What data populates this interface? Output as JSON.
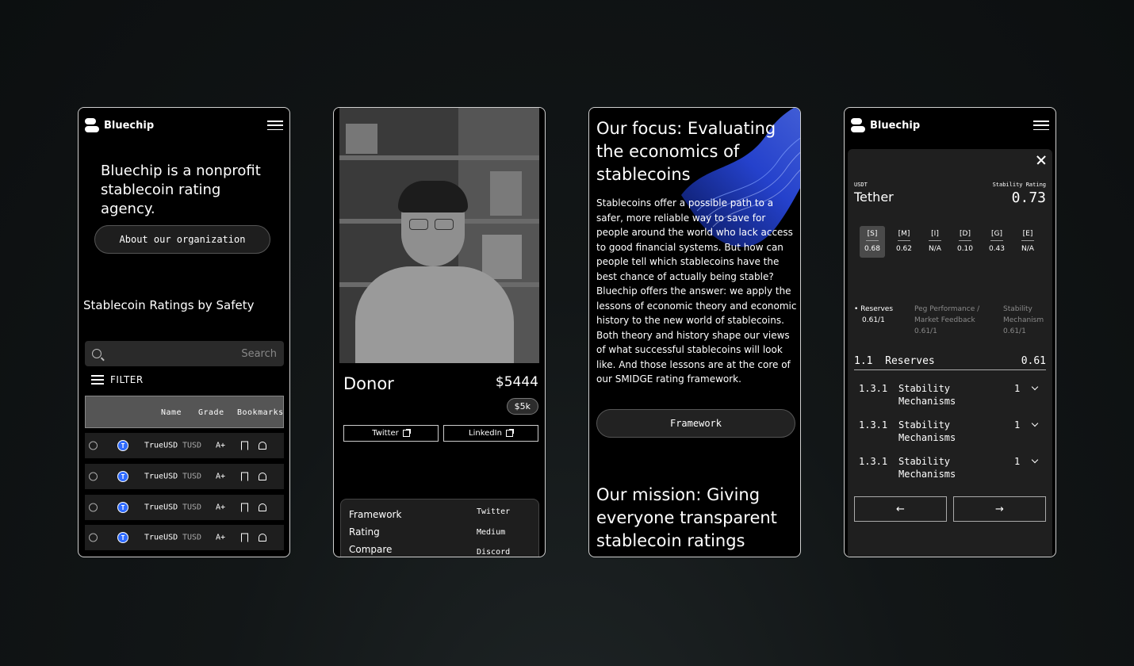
{
  "phone1": {
    "brand": "Bluechip",
    "hero": "Bluechip is a nonprofit stablecoin rating agency.",
    "about_button": "About our organization",
    "section_title": "Stablecoin Ratings by Safety",
    "search_placeholder": "Search",
    "filter_label": "FILTER",
    "columns": [
      "Name",
      "Grade",
      "Bookmarks"
    ],
    "rows": [
      {
        "name": "TrueUSD",
        "symbol": "TUSD",
        "grade": "A+",
        "icon": "T"
      },
      {
        "name": "TrueUSD",
        "symbol": "TUSD",
        "grade": "A+",
        "icon": "T"
      },
      {
        "name": "TrueUSD",
        "symbol": "TUSD",
        "grade": "A+",
        "icon": "T"
      },
      {
        "name": "TrueUSD",
        "symbol": "TUSD",
        "grade": "A+",
        "icon": "T"
      }
    ]
  },
  "phone2": {
    "role": "Donor",
    "amount": "$5444",
    "badge": "$5k",
    "links": [
      "Twitter",
      "LinkedIn"
    ],
    "footer_left": [
      "Framework",
      "Rating",
      "Compare"
    ],
    "footer_right": [
      "Twitter",
      "Medium",
      "Discord"
    ]
  },
  "phone3": {
    "heading": "Our focus: Evaluating the economics of stablecoins",
    "body": "Stablecoins offer a possible path to a safer, more reliable way to save for people around the world who lack access to good financial systems. But how can people tell which stablecoins have the best chance of actually being stable?\nBluechip offers the answer: we apply the lessons of economic theory and economic history to the new world of stablecoins. Both theory and history shape our views of what successful stablecoins will look like. And those lessons are at the core of our SMIDGE rating framework.",
    "framework_button": "Framework",
    "heading2": "Our mission: Giving everyone transparent stablecoin ratings"
  },
  "phone4": {
    "brand": "Bluechip",
    "symbol": "USDT",
    "coin": "Tether",
    "rating_label": "Stability Rating",
    "rating_value": "0.73",
    "grades": [
      {
        "key": "[S]",
        "value": "0.68"
      },
      {
        "key": "[M]",
        "value": "0.62"
      },
      {
        "key": "[I]",
        "value": "N/A"
      },
      {
        "key": "[D]",
        "value": "0.10"
      },
      {
        "key": "[G]",
        "value": "0.43"
      },
      {
        "key": "[E]",
        "value": "N/A"
      }
    ],
    "categories": [
      {
        "title": "• Reserves",
        "value": "0.61/1"
      },
      {
        "title": "Peg Performance / Market Feedback",
        "value": "0.61/1"
      },
      {
        "title": "Stability Mechanism",
        "value": "0.61/1"
      }
    ],
    "section": {
      "number": "1.1",
      "title": "Reserves",
      "value": "0.61"
    },
    "subsections": [
      {
        "number": "1.3.1",
        "title": "Stability Mechanisms",
        "value": "1"
      },
      {
        "number": "1.3.1",
        "title": "Stability Mechanisms",
        "value": "1"
      },
      {
        "number": "1.3.1",
        "title": "Stability Mechanisms",
        "value": "1"
      }
    ],
    "prev": "←",
    "next": "→"
  }
}
